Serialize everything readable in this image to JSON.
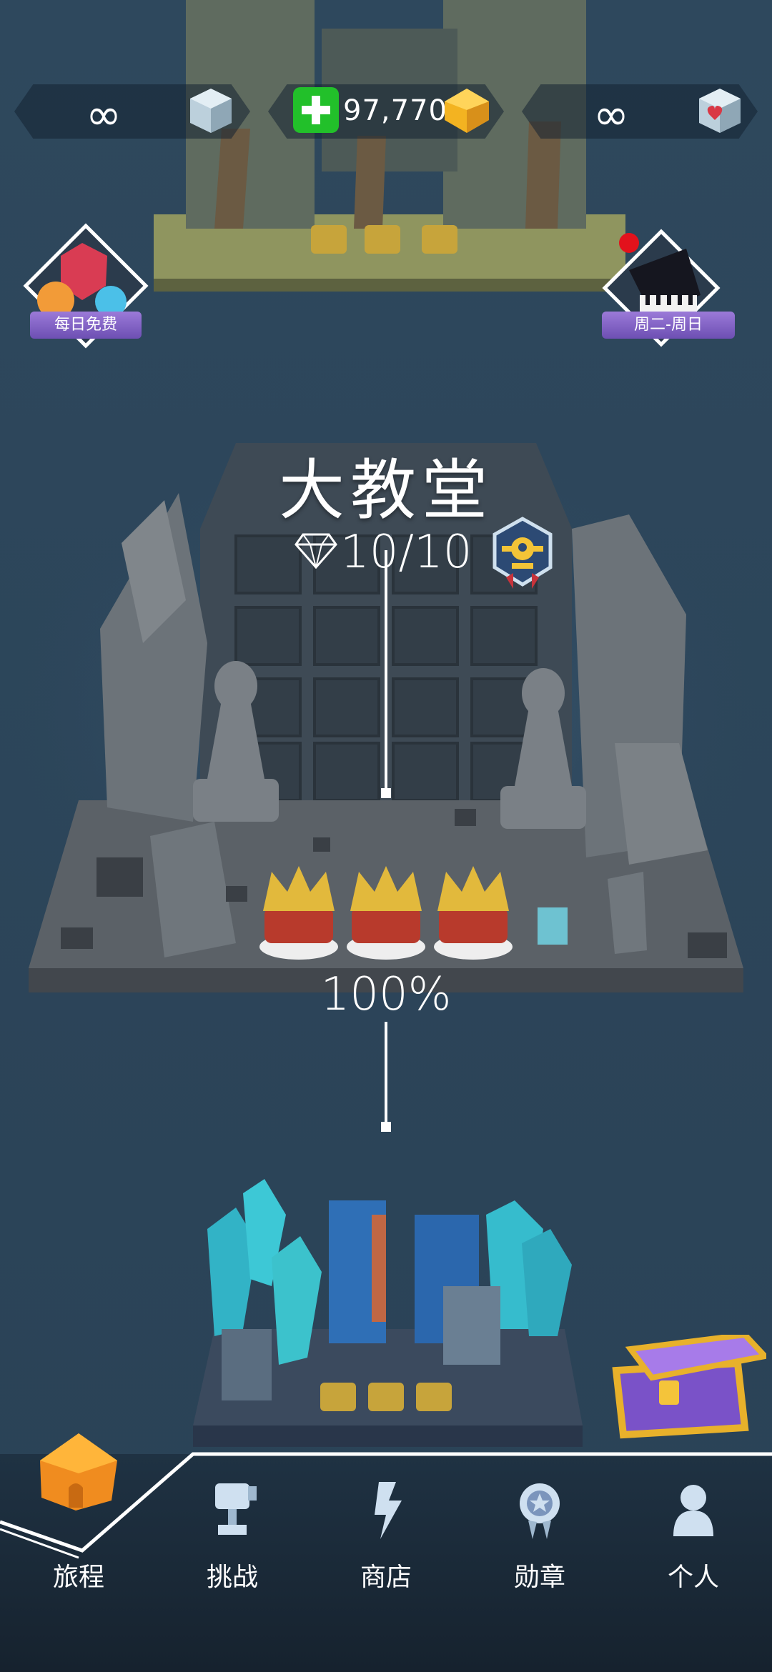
{
  "resources": {
    "left_value": "∞",
    "coins_value": "97,770",
    "right_value": "∞"
  },
  "promos": {
    "daily_free_label": "每日免费",
    "weekly_label": "周二-周日"
  },
  "level": {
    "title": "大教堂",
    "gems_progress": "10/10",
    "completion": "100%"
  },
  "nav": {
    "items": [
      {
        "label": "旅程",
        "icon": "home-icon",
        "active": true
      },
      {
        "label": "挑战",
        "icon": "trophy-icon",
        "active": false
      },
      {
        "label": "商店",
        "icon": "shop-icon",
        "active": false
      },
      {
        "label": "勋章",
        "icon": "medal-icon",
        "active": false
      },
      {
        "label": "个人",
        "icon": "person-icon",
        "active": false
      }
    ]
  },
  "colors": {
    "background": "#2f4a61",
    "nav_bg": "#1c2c3b",
    "accent_green": "#22c02a",
    "gold": "#f3b321",
    "purple_label": "#7a5ac6"
  }
}
